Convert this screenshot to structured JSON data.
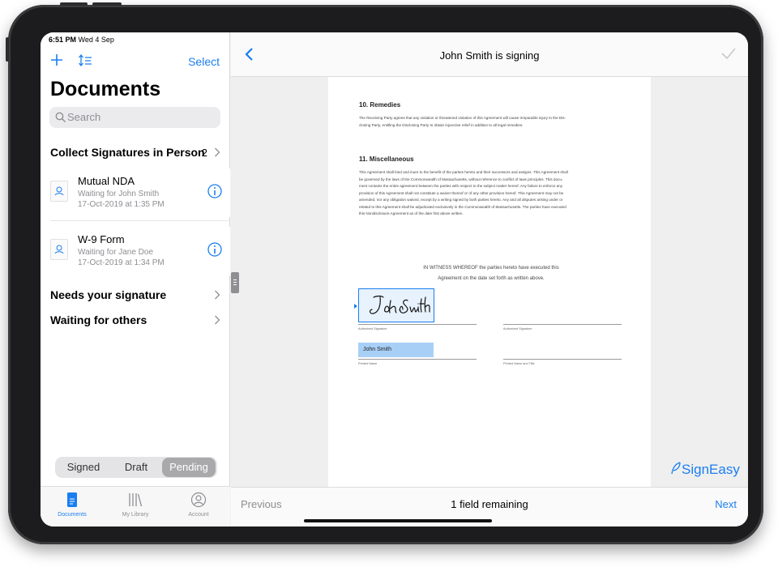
{
  "status_bar": {
    "time": "6:51 PM",
    "date": "Wed 4 Sep"
  },
  "sidebar": {
    "select_label": "Select",
    "title": "Documents",
    "search_placeholder": "Search",
    "collect": {
      "label": "Collect Signatures in Person",
      "count": "2"
    },
    "documents": [
      {
        "name": "Mutual NDA",
        "status": "Waiting for John Smith",
        "date": "17-Oct-2019 at 1:35 PM"
      },
      {
        "name": "W-9 Form",
        "status": "Waiting for Jane Doe",
        "date": "17-Oct-2019 at 1:34 PM"
      }
    ],
    "sections": [
      {
        "label": "Needs your signature"
      },
      {
        "label": "Waiting for others"
      }
    ],
    "segments": [
      {
        "label": "Signed",
        "active": false
      },
      {
        "label": "Draft",
        "active": false
      },
      {
        "label": "Pending",
        "active": true
      }
    ],
    "tabs": [
      {
        "label": "Documents",
        "icon": "document-icon",
        "active": true
      },
      {
        "label": "My Library",
        "icon": "library-icon",
        "active": false
      },
      {
        "label": "Account",
        "icon": "account-icon",
        "active": false
      }
    ]
  },
  "navbar": {
    "title": "John Smith is signing"
  },
  "document": {
    "section10": {
      "heading": "10. Remedies",
      "lines": [
        "The Receiving Party agrees that any violation or threatened violation of this Agreement will cause irreparable injury to the Dis-",
        "closing Party, entitling the Disclosing Party to obtain injunctive relief in addition to all legal remedies."
      ]
    },
    "section11": {
      "heading": "11. Miscellaneous",
      "lines": [
        "This Agreement shall bind and inure to the benefit of the parties hereto and their successors and assigns. This Agreement shall",
        "be governed by the laws of the Commonwealth of Massachusetts, without reference to conflict of laws principles. This docu-",
        "ment contains the entire agreement between the parties with respect to the subject matter hereof. Any failure to enforce any",
        "provision of this Agreement shall not constitute a waiver thereof or of any other provision hereof. This Agreement may not be",
        "amended, nor any obligation waived, except by a writing signed by both parties hereto. Any and all disputes arising under or",
        "related to this Agreement shall be adjudicated exclusively in the Commonwealth of Massachusetts. The parties have executed",
        "this Nondisclosure Agreement as of the date first above written."
      ]
    },
    "witness": [
      "IN WITNESS WHEREOF the parties hereto have executed this",
      "Agreement on the date set forth as written above."
    ],
    "signature_text": "John Smith",
    "authorized_signature_label": "Authorized Signature",
    "printed_name_value": "John Smith",
    "printed_name_label": "Printed Name",
    "printed_name_title_label": "Printed Name and Title"
  },
  "brand": {
    "name": "SignEasy"
  },
  "bottombar": {
    "previous": "Previous",
    "remaining": "1 field remaining",
    "next": "Next"
  },
  "colors": {
    "accent": "#1a7ef0",
    "segment_active": "#a9a9ab",
    "name_field": "#a8d0f7"
  }
}
